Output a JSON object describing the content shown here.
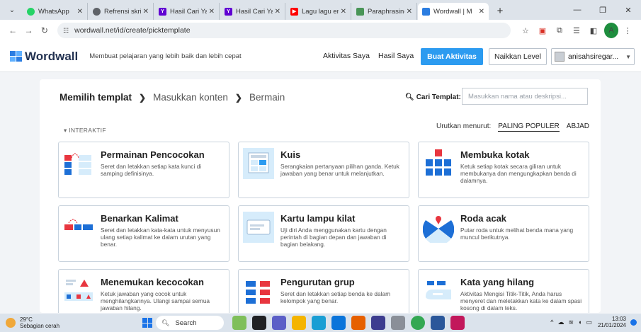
{
  "browser": {
    "tabs": [
      {
        "title": "WhatsApp",
        "icon": "whatsapp-icon",
        "color": "#25d366"
      },
      {
        "title": "Refrensi skrip",
        "icon": "globe-icon",
        "color": "#5f6368"
      },
      {
        "title": "Hasil Cari Yah",
        "icon": "yahoo-icon",
        "color": "#6001d2"
      },
      {
        "title": "Hasil Cari Yah",
        "icon": "yahoo-icon",
        "color": "#6001d2"
      },
      {
        "title": "Lagu lagu en",
        "icon": "youtube-icon",
        "color": "#ff0000"
      },
      {
        "title": "Paraphrasing",
        "icon": "quillbot-icon",
        "color": "#499557"
      },
      {
        "title": "Wordwall | M",
        "icon": "wordwall-icon",
        "color": "#2b7de1",
        "active": true
      }
    ],
    "url": "wordwall.net/id/create/picktemplate",
    "profile_initial": "A"
  },
  "header": {
    "logo": "Wordwall",
    "tagline": "Membuat pelajaran yang lebih baik dan lebih cepat",
    "my_activities": "Aktivitas Saya",
    "my_results": "Hasil Saya",
    "create": "Buat Aktivitas",
    "upgrade": "Naikkan Level",
    "username": "anisahsiregar..."
  },
  "steps": {
    "current": "Memilih templat",
    "next": "Masukkan konten",
    "last": "Bermain"
  },
  "search": {
    "label": "Cari Templat:",
    "placeholder": "Masukkan nama atau deskripsi..."
  },
  "section_label": "INTERAKTIF",
  "sort": {
    "label": "Urutkan menurut:",
    "popular": "PALING POPULER",
    "alpha": "ABJAD"
  },
  "templates": [
    {
      "title": "Permainan Pencocokan",
      "desc": "Seret dan letakkan setiap kata kunci di samping definisinya."
    },
    {
      "title": "Kuis",
      "desc": "Serangkaian pertanyaan pilihan ganda. Ketuk jawaban yang benar untuk melanjutkan."
    },
    {
      "title": "Membuka kotak",
      "desc": "Ketuk setiap kotak secara giliran untuk membukanya dan mengungkapkan benda di dalamnya."
    },
    {
      "title": "Benarkan Kalimat",
      "desc": "Seret dan letakkan kata-kata untuk menyusun ulang setiap kalimat ke dalam urutan yang benar."
    },
    {
      "title": "Kartu lampu kilat",
      "desc": "Uji diri Anda menggunakan kartu dengan perintah di bagian depan dan jawaban di bagian belakang."
    },
    {
      "title": "Roda acak",
      "desc": "Putar roda untuk melihat benda mana yang muncul berikutnya."
    },
    {
      "title": "Menemukan kecocokan",
      "desc": "Ketuk jawaban yang cocok untuk menghilangkannya. Ulangi sampai semua jawaban hilang."
    },
    {
      "title": "Pengurutan grup",
      "desc": "Seret dan letakkan setiap benda ke dalam kelompok yang benar."
    },
    {
      "title": "Kata yang hilang",
      "desc": "Aktivitas Mengisi Titik-Titik, Anda harus menyeret dan meletakkan kata ke dalam spasi kosong di dalam teks."
    }
  ],
  "taskbar": {
    "temp": "29°C",
    "weather": "Sebagian cerah",
    "search": "Search",
    "time": "13:03",
    "date": "21/01/2024"
  },
  "colors": {
    "accent": "#2c9bf0",
    "thumb_bg": "#d6ecfb",
    "red": "#e8363f",
    "blue": "#1d6fd6"
  }
}
